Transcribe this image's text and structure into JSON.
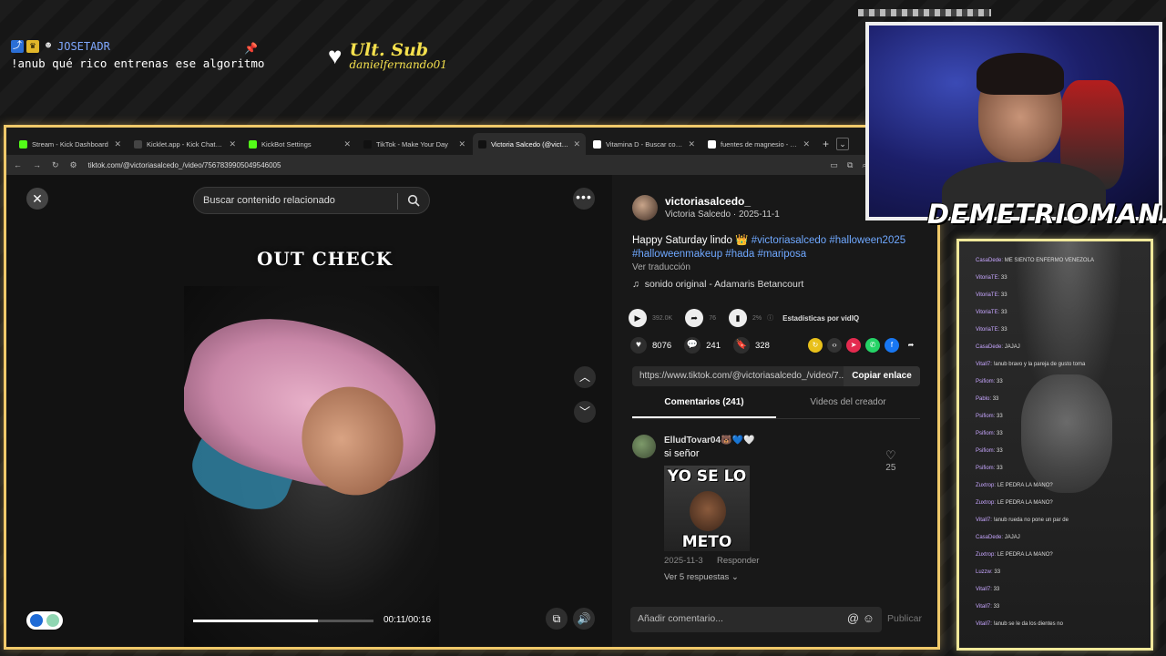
{
  "overlay": {
    "chat_user": "JOSETADR",
    "chat_message": "!anub qué rico entrenas ese algoritmo",
    "ult_sub_title": "Ult. Sub",
    "ult_sub_name": "danielfernando01",
    "streamer_name": "DEMETRIOMAN..."
  },
  "browser": {
    "tabs": [
      {
        "label": "Stream - Kick Dashboard",
        "color": "#53fc18",
        "active": false
      },
      {
        "label": "Kicklet.app - Kick Chatbot and",
        "color": "#444",
        "active": false
      },
      {
        "label": "KickBot Settings",
        "color": "#53fc18",
        "active": false
      },
      {
        "label": "TikTok - Make Your Day",
        "color": "#111",
        "active": false
      },
      {
        "label": "Victoria Salcedo (@victoria",
        "color": "#111",
        "active": true
      },
      {
        "label": "Vitamina D - Buscar con Googl",
        "color": "#fff",
        "active": false
      },
      {
        "label": "fuentes de magnesio - Buscar c",
        "color": "#fff",
        "active": false
      }
    ],
    "url": "tiktok.com/@victoriasalcedo_/video/7567839905049546005"
  },
  "video": {
    "search_placeholder": "Buscar contenido relacionado",
    "overlay_text": "OUT CHECK",
    "time": "00:11/00:16",
    "progress": 0.69
  },
  "panel": {
    "username": "victoriasalcedo_",
    "byline": "Victoria Salcedo · 2025-11-1",
    "desc_text": "Happy Saturday lindo",
    "desc_emoji": "👑",
    "tags_line1": "#victoriasalcedo #halloween2025",
    "tags_line2": "#halloweenmakeup #hada #mariposa",
    "translate": "Ver traducción",
    "sound": "sonido original - Adamaris Betancourt",
    "views": "392.0K",
    "shares_stat": "76",
    "pct": "2%",
    "vidiq": "Estadísticas por vidIQ",
    "likes": "8076",
    "comments": "241",
    "saves": "328",
    "link": "https://www.tiktok.com/@victoriasalcedo_/video/7...",
    "copy_label": "Copiar enlace",
    "tab_comments": "Comentarios (241)",
    "tab_creator": "Videos del creador",
    "comment": {
      "user": "ElludTovar04🐻💙🤍",
      "text": "si señor",
      "meme_top": "YO SE LO",
      "meme_bottom": "METO",
      "date": "2025-11-3",
      "reply": "Responder",
      "more": "Ver 5 respuestas ⌄",
      "likes": "25"
    },
    "add_comment": "Añadir comentario...",
    "publish": "Publicar"
  },
  "chat_lines": [
    {
      "user": "CasaDede:",
      "text": "ME SIENTO ENFERMO VENEZOLA"
    },
    {
      "user": "VitoriaTE:",
      "text": "33"
    },
    {
      "user": "VitoriaTE:",
      "text": "33"
    },
    {
      "user": "VitoriaTE:",
      "text": "33"
    },
    {
      "user": "VitoriaTE:",
      "text": "33"
    },
    {
      "user": "CasaDede:",
      "text": "JAJAJ"
    },
    {
      "user": "Vitall7:",
      "text": "!anub bravo y la pareja de gusto toma"
    },
    {
      "user": "Psifiom:",
      "text": "33"
    },
    {
      "user": "Pablo:",
      "text": "33"
    },
    {
      "user": "Psifiom:",
      "text": "33"
    },
    {
      "user": "Psifiom:",
      "text": "33"
    },
    {
      "user": "Psifiom:",
      "text": "33"
    },
    {
      "user": "Psifiom:",
      "text": "33"
    },
    {
      "user": "Zuxtrop:",
      "text": "LE PEDRA LA MANO?"
    },
    {
      "user": "Zuxtrop:",
      "text": "LE PEDRA LA MANO?"
    },
    {
      "user": "Vitall7:",
      "text": "!anub rueda no pone un par de"
    },
    {
      "user": "CasaDede:",
      "text": "JAJAJ"
    },
    {
      "user": "Zuxtrop:",
      "text": "LE PEDRA LA MANO?"
    },
    {
      "user": "Luzzw:",
      "text": "33"
    },
    {
      "user": "Vitall7:",
      "text": "33"
    },
    {
      "user": "Vitall7:",
      "text": "33"
    },
    {
      "user": "Vitall7:",
      "text": "!anub se le da los dientes no"
    }
  ]
}
